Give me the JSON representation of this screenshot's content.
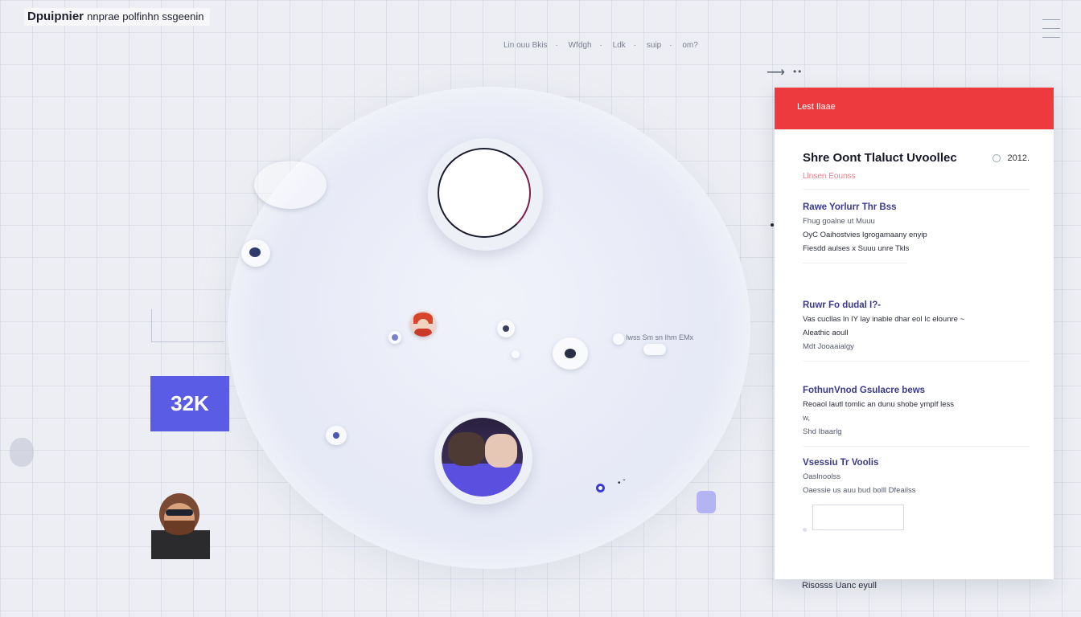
{
  "app": {
    "title": "Dpuipnier",
    "subtitle": "nnprae polfinhn ssgeenin"
  },
  "top_meta": [
    "Lin ouu Bkis",
    "Wfdgh",
    "Ldk",
    "suip",
    "om?"
  ],
  "stat_card": {
    "value": "32K"
  },
  "edge_label": "Iwss Sm sn Ihm EMx",
  "panel": {
    "header_label": "Lest Ilaae",
    "title": "Shre Oont Tlaluct Uvoollec",
    "date": "2012.",
    "subtitle": "Llnsen Eounss",
    "sections": [
      {
        "heading": "Rawe Yorlurr Thr Bss",
        "lines": [
          "Fhug goalne ut Muuu",
          "OyC Oaihostvies Igrogamaany enyip",
          "Fiesdd aulses x Suuu unre Tkls"
        ]
      },
      {
        "heading": "Ruwr Fo dudal I?-",
        "lines": [
          "Vas cucllas ln IY lay inable dhar eol Ic elounre ~",
          "Aleathic aoull",
          "Mdt Jooaaialgy"
        ]
      },
      {
        "heading": "FothunVnod Gsulacre bews",
        "lines": [
          "Reoaol lautl tomlic an dunu shobe ymplf less",
          "w,",
          "Shd Ibaarlg"
        ]
      },
      {
        "heading": "Vsessiu Tr Voolis",
        "lines": [
          "Oaslnoolss",
          "Oaessie us auu bud bolll Dfeailss"
        ]
      }
    ]
  },
  "footer": "Risosss Uanc eyull"
}
